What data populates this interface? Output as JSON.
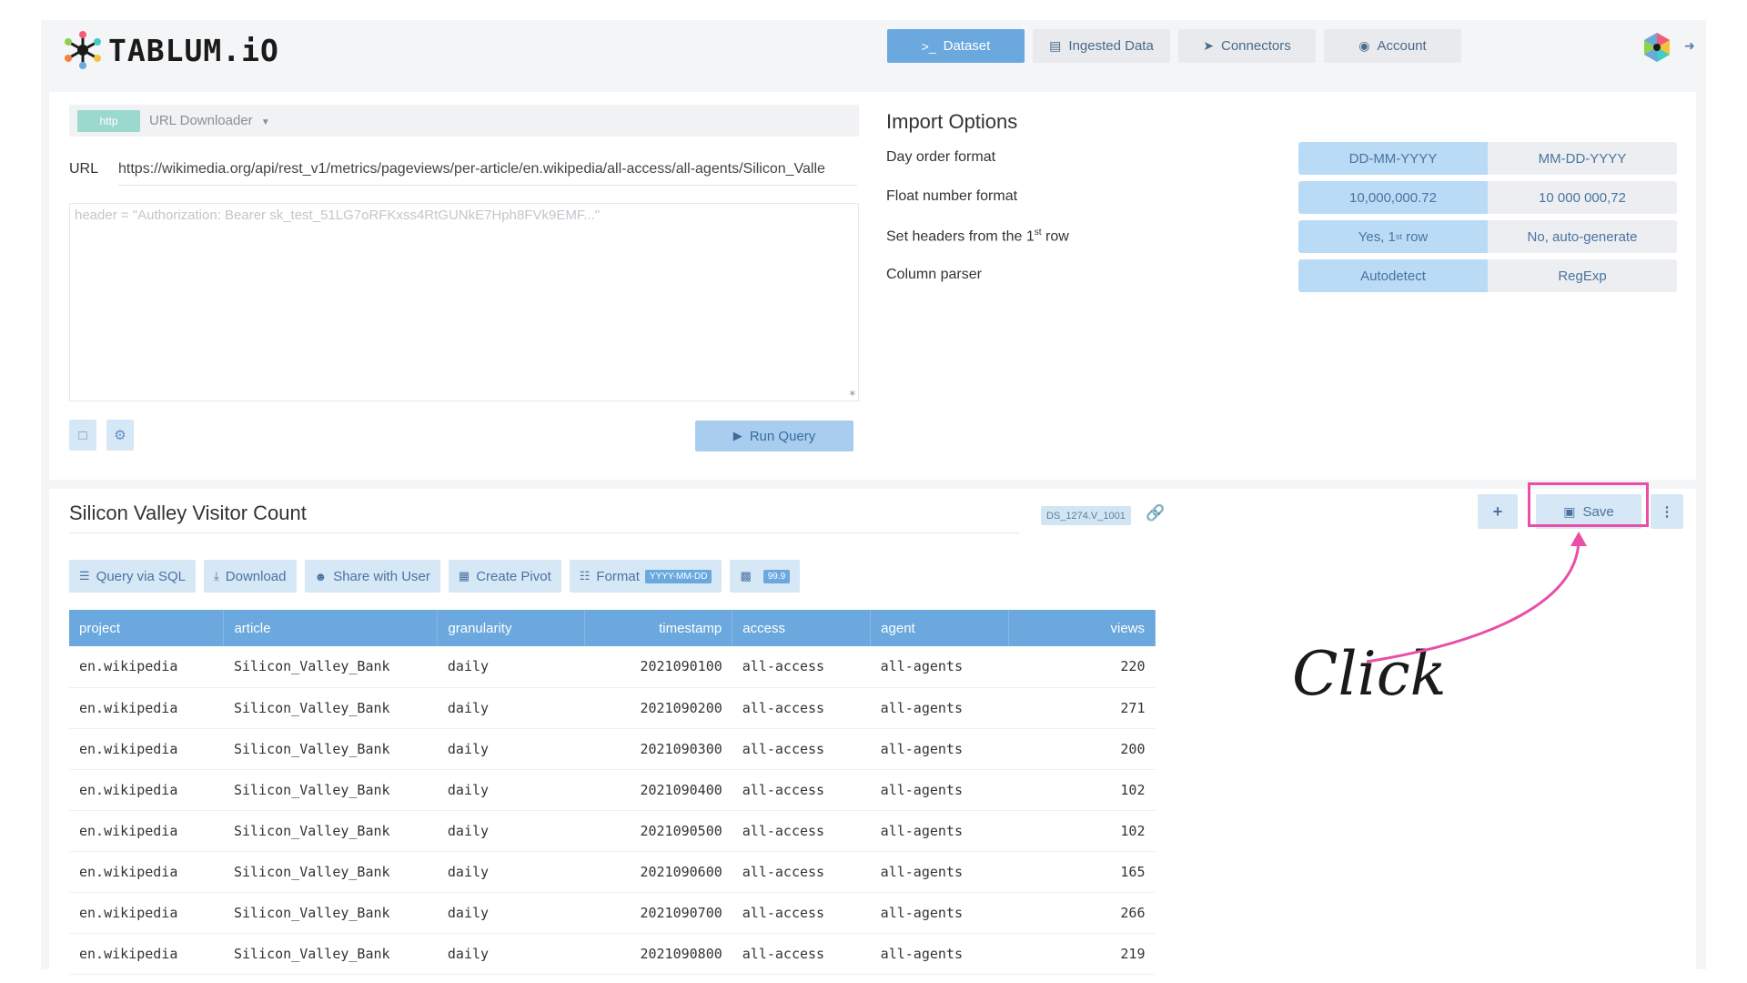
{
  "header": {
    "logo_text": "TABLUM.iO",
    "nav": [
      {
        "label": "Dataset",
        "icon": "terminal-icon",
        "active": true
      },
      {
        "label": "Ingested Data",
        "icon": "table-icon",
        "active": false
      },
      {
        "label": "Connectors",
        "icon": "plug-icon",
        "active": false
      },
      {
        "label": "Account",
        "icon": "user-circle-icon",
        "active": false
      }
    ]
  },
  "import": {
    "source_badge": "http",
    "source_label": "URL Downloader",
    "url_label": "URL",
    "url_value": "https://wikimedia.org/api/rest_v1/metrics/pageviews/per-article/en.wikipedia/all-access/all-agents/Silicon_Valle",
    "header_placeholder": "header = \"Authorization: Bearer sk_test_51LG7oRFKxss4RtGUNkE7Hph8FVk9EMF...\"",
    "run_label": "Run Query"
  },
  "import_options": {
    "title": "Import Options",
    "rows": [
      {
        "label": "Day order format",
        "options": [
          "DD-MM-YYYY",
          "MM-DD-YYYY"
        ],
        "selected": 0
      },
      {
        "label": "Float number format",
        "options": [
          "10,000,000.72",
          "10 000 000,72"
        ],
        "selected": 0
      },
      {
        "label": "Set headers from the 1st row",
        "options": [
          "Yes, 1st row",
          "No, auto-generate"
        ],
        "selected": 0
      },
      {
        "label": "Column parser",
        "options": [
          "Autodetect",
          "RegExp"
        ],
        "selected": 0
      }
    ]
  },
  "dataset": {
    "title": "Silicon Valley Visitor Count",
    "badge": "DS_1274.V_1001",
    "save_label": "Save",
    "add_label": "+",
    "menu_label": "⋮",
    "toolbar": {
      "query_sql": "Query via SQL",
      "download": "Download",
      "share": "Share with User",
      "pivot": "Create Pivot",
      "format": "Format",
      "format_badge": "YYYY-MM-DD",
      "number_badge": "99.9"
    },
    "columns": [
      "project",
      "article",
      "granularity",
      "timestamp",
      "access",
      "agent",
      "views"
    ],
    "rows": [
      [
        "en.wikipedia",
        "Silicon_Valley_Bank",
        "daily",
        "2021090100",
        "all-access",
        "all-agents",
        "220"
      ],
      [
        "en.wikipedia",
        "Silicon_Valley_Bank",
        "daily",
        "2021090200",
        "all-access",
        "all-agents",
        "271"
      ],
      [
        "en.wikipedia",
        "Silicon_Valley_Bank",
        "daily",
        "2021090300",
        "all-access",
        "all-agents",
        "200"
      ],
      [
        "en.wikipedia",
        "Silicon_Valley_Bank",
        "daily",
        "2021090400",
        "all-access",
        "all-agents",
        "102"
      ],
      [
        "en.wikipedia",
        "Silicon_Valley_Bank",
        "daily",
        "2021090500",
        "all-access",
        "all-agents",
        "102"
      ],
      [
        "en.wikipedia",
        "Silicon_Valley_Bank",
        "daily",
        "2021090600",
        "all-access",
        "all-agents",
        "165"
      ],
      [
        "en.wikipedia",
        "Silicon_Valley_Bank",
        "daily",
        "2021090700",
        "all-access",
        "all-agents",
        "266"
      ],
      [
        "en.wikipedia",
        "Silicon_Valley_Bank",
        "daily",
        "2021090800",
        "all-access",
        "all-agents",
        "219"
      ]
    ]
  },
  "annotation": {
    "text": "Click",
    "color": "#e94fa6"
  }
}
